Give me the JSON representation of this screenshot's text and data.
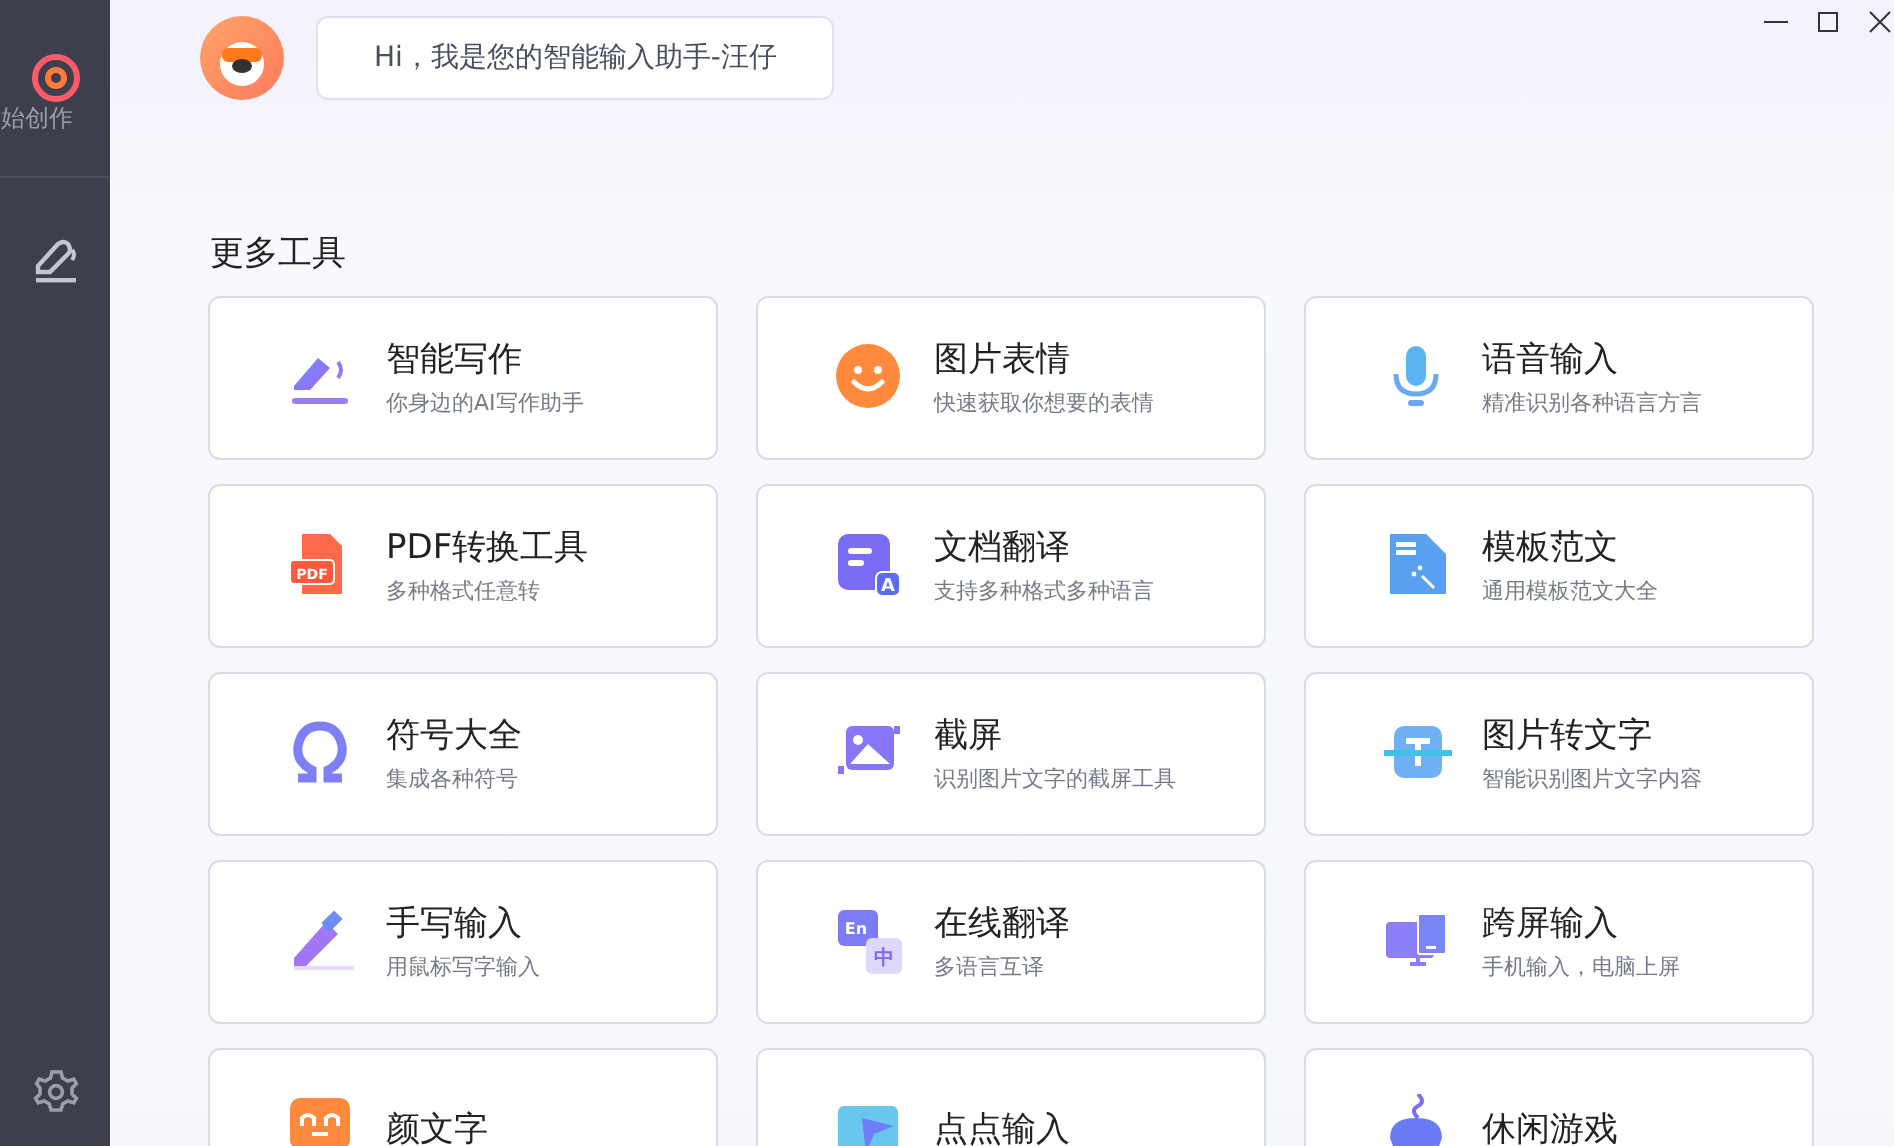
{
  "sidebar": {
    "items": [
      {
        "label": "始创作",
        "selected": true
      },
      {
        "selected": false
      }
    ]
  },
  "assistant": {
    "greeting": "Hi，我是您的智能输入助手-汪仔"
  },
  "section_title": "更多工具",
  "tools": [
    {
      "title": "智能写作",
      "subtitle": "你身边的AI写作助手"
    },
    {
      "title": "图片表情",
      "subtitle": "快速获取你想要的表情"
    },
    {
      "title": "语音输入",
      "subtitle": "精准识别各种语言方言"
    },
    {
      "title": "PDF转换工具",
      "subtitle": "多种格式任意转",
      "icon_labels": [
        "PDF"
      ]
    },
    {
      "title": "文档翻译",
      "subtitle": "支持多种格式多种语言",
      "icon_labels": [
        "A"
      ]
    },
    {
      "title": "模板范文",
      "subtitle": "通用模板范文大全"
    },
    {
      "title": "符号大全",
      "subtitle": "集成各种符号"
    },
    {
      "title": "截屏",
      "subtitle": "识别图片文字的截屏工具"
    },
    {
      "title": "图片转文字",
      "subtitle": "智能识别图片文字内容"
    },
    {
      "title": "手写输入",
      "subtitle": "用鼠标写字输入"
    },
    {
      "title": "在线翻译",
      "subtitle": "多语言互译",
      "icon_labels": [
        "En",
        "中"
      ]
    },
    {
      "title": "跨屏输入",
      "subtitle": "手机输入，电脑上屏"
    },
    {
      "title": "颜文字"
    },
    {
      "title": "点点输入"
    },
    {
      "title": "休闲游戏"
    }
  ]
}
